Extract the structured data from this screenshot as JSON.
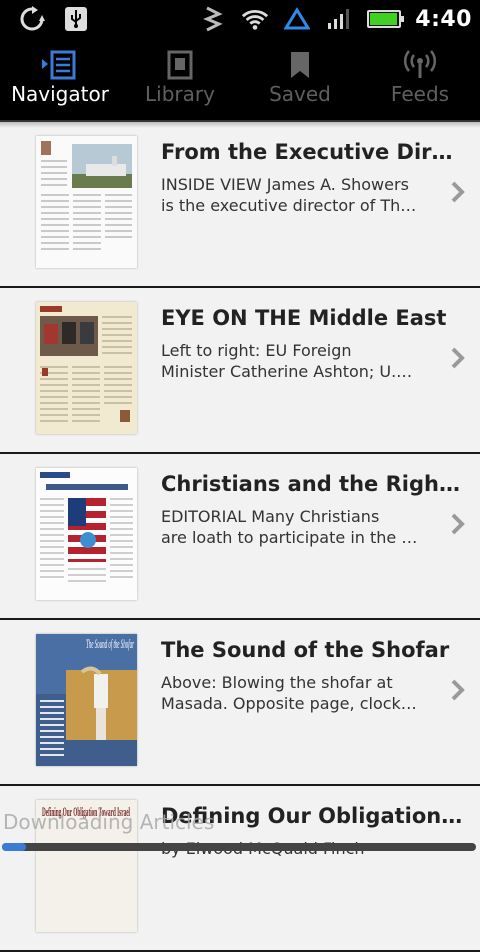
{
  "status_bar": {
    "time": "4:40",
    "icons": [
      "sync-icon",
      "usb-icon",
      "vibrate-icon",
      "wifi-icon",
      "data-arrow-icon",
      "signal-icon",
      "battery-icon"
    ],
    "battery_level": 0.9
  },
  "tabs": [
    {
      "label": "Navigator",
      "icon": "navigator-list-icon",
      "active": true
    },
    {
      "label": "Library",
      "icon": "library-icon",
      "active": false
    },
    {
      "label": "Saved",
      "icon": "bookmark-icon",
      "active": false
    },
    {
      "label": "Feeds",
      "icon": "feeds-broadcast-icon",
      "active": false
    }
  ],
  "articles": [
    {
      "title": "From the Executive Direc…",
      "snippet_line1": "INSIDE VIEW James A. Showers",
      "snippet_line2": "is the executive director of Th…"
    },
    {
      "title": "EYE ON THE Middle East",
      "snippet_line1": "Left to right: EU Foreign",
      "snippet_line2": "Minister Catherine Ashton; U.…"
    },
    {
      "title": "Christians and the Right t…",
      "snippet_line1": "EDITORIAL Many Christians",
      "snippet_line2": "are loath to participate in the …"
    },
    {
      "title": "The Sound of the Shofar",
      "snippet_line1": "Above: Blowing the shofar at",
      "snippet_line2": "Masada. Opposite page, clock…"
    },
    {
      "title": "Defining Our Obligation T…",
      "snippet_line1": "by Elwood McQuaid Finch",
      "snippet_line2": ""
    }
  ],
  "thumb_text": {
    "shofar_title": "The Sound of the Shofar",
    "defining_title": "Defining Our Obligation Toward Israel"
  },
  "toast": "Downloading Articles",
  "download_progress": 0.05,
  "colors": {
    "accent": "#3b7bd6",
    "tab_active": "#ffffff",
    "tab_inactive": "#5f5f5f"
  }
}
